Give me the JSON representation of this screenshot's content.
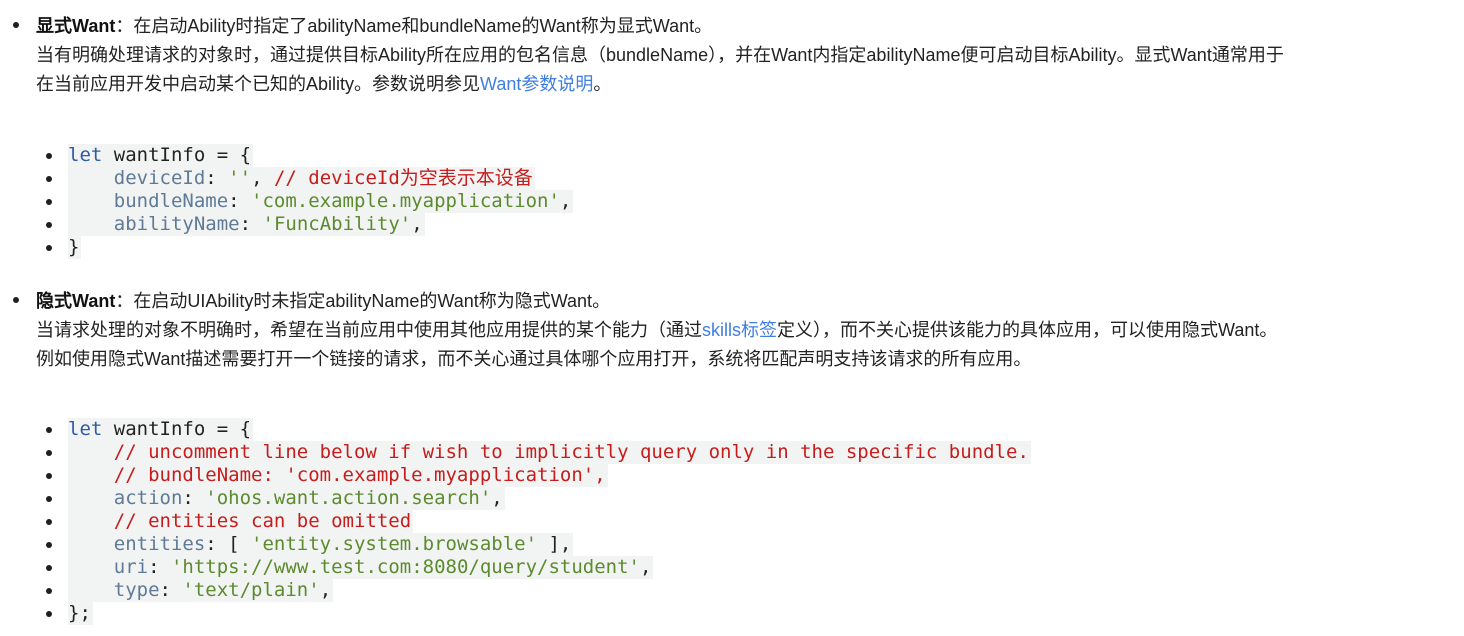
{
  "explicit": {
    "term": "显式Want",
    "line1_rest": "：在启动Ability时指定了abilityName和bundleName的Want称为显式Want。",
    "line2": "当有明确处理请求的对象时，通过提供目标Ability所在应用的包名信息（bundleName），并在Want内指定abilityName便可启动目标Ability。显式Want通常用于",
    "line3_pre": "在当前应用开发中启动某个已知的Ability。参数说明参见",
    "line3_link": "Want参数说明",
    "line3_post": "。",
    "code": [
      [
        {
          "c": "kw",
          "t": "let"
        },
        {
          "c": "pl",
          "t": " wantInfo = {"
        }
      ],
      [
        {
          "c": "pl",
          "t": "    "
        },
        {
          "c": "prop",
          "t": "deviceId"
        },
        {
          "c": "pl",
          "t": ": "
        },
        {
          "c": "str",
          "t": "''"
        },
        {
          "c": "pl",
          "t": ", "
        },
        {
          "c": "com",
          "t": "// deviceId为空表示本设备"
        }
      ],
      [
        {
          "c": "pl",
          "t": "    "
        },
        {
          "c": "prop",
          "t": "bundleName"
        },
        {
          "c": "pl",
          "t": ": "
        },
        {
          "c": "str",
          "t": "'com.example.myapplication'"
        },
        {
          "c": "pl",
          "t": ","
        }
      ],
      [
        {
          "c": "pl",
          "t": "    "
        },
        {
          "c": "prop",
          "t": "abilityName"
        },
        {
          "c": "pl",
          "t": ": "
        },
        {
          "c": "str",
          "t": "'FuncAbility'"
        },
        {
          "c": "pl",
          "t": ","
        }
      ],
      [
        {
          "c": "pl",
          "t": "}"
        }
      ]
    ]
  },
  "implicit": {
    "term": "隐式Want",
    "line1_rest": "：在启动UIAbility时未指定abilityName的Want称为隐式Want。",
    "line2_pre": "当请求处理的对象不明确时，希望在当前应用中使用其他应用提供的某个能力（通过",
    "line2_link": "skills标签",
    "line2_post": "定义），而不关心提供该能力的具体应用，可以使用隐式Want。",
    "line3": "例如使用隐式Want描述需要打开一个链接的请求，而不关心通过具体哪个应用打开，系统将匹配声明支持该请求的所有应用。",
    "code": [
      [
        {
          "c": "kw",
          "t": "let"
        },
        {
          "c": "pl",
          "t": " wantInfo = {"
        }
      ],
      [
        {
          "c": "pl",
          "t": "    "
        },
        {
          "c": "com",
          "t": "// uncomment line below if wish to implicitly query only in the specific bundle."
        }
      ],
      [
        {
          "c": "pl",
          "t": "    "
        },
        {
          "c": "com",
          "t": "// bundleName: 'com.example.myapplication',"
        }
      ],
      [
        {
          "c": "pl",
          "t": "    "
        },
        {
          "c": "prop",
          "t": "action"
        },
        {
          "c": "pl",
          "t": ": "
        },
        {
          "c": "str",
          "t": "'ohos.want.action.search'"
        },
        {
          "c": "pl",
          "t": ","
        }
      ],
      [
        {
          "c": "pl",
          "t": "    "
        },
        {
          "c": "com",
          "t": "// entities can be omitted"
        }
      ],
      [
        {
          "c": "pl",
          "t": "    "
        },
        {
          "c": "prop",
          "t": "entities"
        },
        {
          "c": "pl",
          "t": ": [ "
        },
        {
          "c": "str",
          "t": "'entity.system.browsable'"
        },
        {
          "c": "pl",
          "t": " ],"
        }
      ],
      [
        {
          "c": "pl",
          "t": "    "
        },
        {
          "c": "prop",
          "t": "uri"
        },
        {
          "c": "pl",
          "t": ": "
        },
        {
          "c": "str",
          "t": "'https://www.test.com:8080/query/student'"
        },
        {
          "c": "pl",
          "t": ","
        }
      ],
      [
        {
          "c": "pl",
          "t": "    "
        },
        {
          "c": "prop",
          "t": "type"
        },
        {
          "c": "pl",
          "t": ": "
        },
        {
          "c": "str",
          "t": "'text/plain'"
        },
        {
          "c": "pl",
          "t": ","
        }
      ],
      [
        {
          "c": "pl",
          "t": "};"
        }
      ]
    ]
  }
}
